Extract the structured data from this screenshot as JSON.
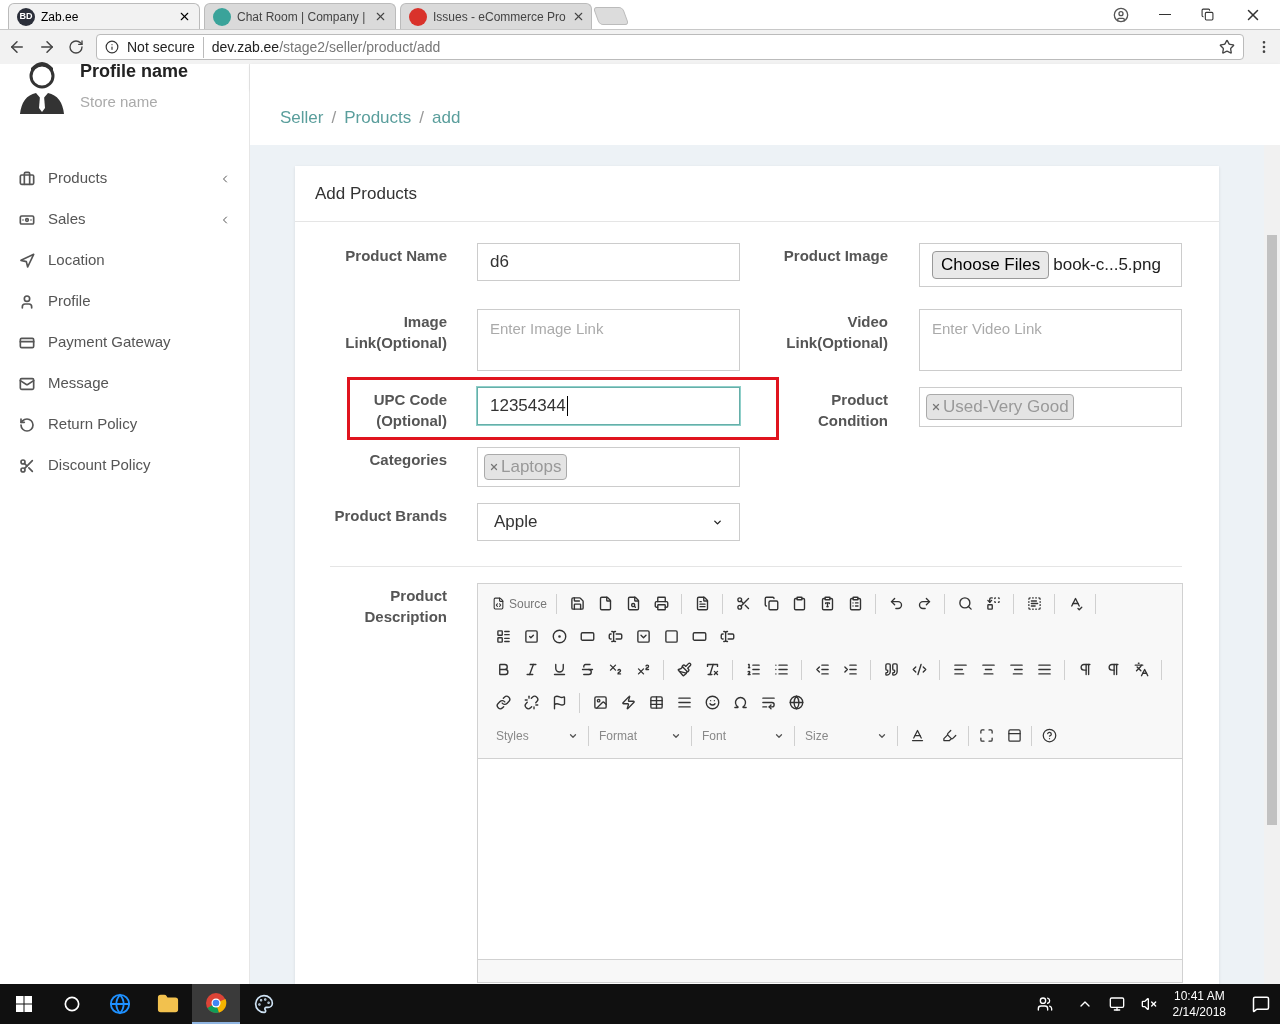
{
  "browser": {
    "tabs": [
      {
        "title": "Zab.ee",
        "selected": true,
        "color": "#2b2f3a",
        "favicon_text": "BD"
      },
      {
        "title": "Chat Room | Company | ",
        "selected": false,
        "color": "#3aa39a"
      },
      {
        "title": "Issues - eCommerce Pro",
        "selected": false,
        "color": "#d9322b"
      }
    ],
    "address": {
      "security": "Not secure",
      "host": "dev.zab.ee",
      "path": "/stage2/seller/product/add"
    }
  },
  "profile": {
    "name": "Profile name",
    "store": "Store name"
  },
  "sidebar": {
    "items": [
      {
        "label": "Products",
        "has_submenu": true
      },
      {
        "label": "Sales",
        "has_submenu": true
      },
      {
        "label": "Location",
        "has_submenu": false
      },
      {
        "label": "Profile",
        "has_submenu": false
      },
      {
        "label": "Payment Gateway",
        "has_submenu": false
      },
      {
        "label": "Message",
        "has_submenu": false
      },
      {
        "label": "Return Policy",
        "has_submenu": false
      },
      {
        "label": "Discount Policy",
        "has_submenu": false
      }
    ]
  },
  "breadcrumb": {
    "separator": "/",
    "items": [
      "Seller",
      "Products",
      "add"
    ]
  },
  "card": {
    "title": "Add Products"
  },
  "form": {
    "rows": [
      {
        "left": {
          "kind": "text",
          "label": "Product Name",
          "value": "d6"
        },
        "right": {
          "kind": "file",
          "label": "Product Image",
          "button": "Choose Files",
          "file": "book-c...5.png"
        }
      },
      {
        "left": {
          "kind": "textarea",
          "label": "Image Link(Optional)",
          "placeholder": "Enter Image Link"
        },
        "right": {
          "kind": "textarea",
          "label": "Video Link(Optional)",
          "placeholder": "Enter Video Link"
        }
      },
      {
        "left": {
          "kind": "text",
          "label": "UPC Code (Optional)",
          "value": "12354344",
          "focused": true,
          "highlighted": true
        },
        "right": {
          "kind": "tags",
          "label": "Product Condition",
          "tags": [
            "Used-Very Good"
          ]
        }
      },
      {
        "left": {
          "kind": "tags",
          "label": "Categories",
          "tags": [
            "Laptops"
          ]
        }
      },
      {
        "left": {
          "kind": "select",
          "label": "Product Brands",
          "value": "Apple"
        }
      }
    ]
  },
  "description": {
    "label": "Product Description",
    "source_button": "Source",
    "combos": [
      "Styles",
      "Format",
      "Font",
      "Size"
    ]
  },
  "taskbar": {
    "time": "10:41 AM",
    "date": "2/14/2018"
  }
}
